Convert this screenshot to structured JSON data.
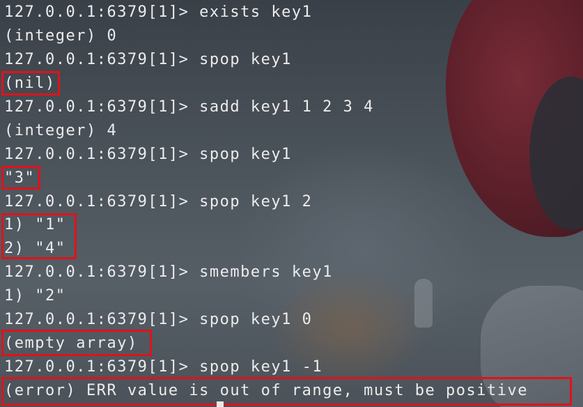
{
  "terminal": {
    "lines": [
      {
        "text": "127.0.0.1:6379[1]> exists key1",
        "kind": "prompt"
      },
      {
        "text": "(integer) 0",
        "kind": "output"
      },
      {
        "text": "127.0.0.1:6379[1]> spop key1",
        "kind": "prompt"
      },
      {
        "text": "(nil)",
        "kind": "output"
      },
      {
        "text": "127.0.0.1:6379[1]> sadd key1 1 2 3 4",
        "kind": "prompt"
      },
      {
        "text": "(integer) 4",
        "kind": "output"
      },
      {
        "text": "127.0.0.1:6379[1]> spop key1",
        "kind": "prompt"
      },
      {
        "text": "\"3\"",
        "kind": "output"
      },
      {
        "text": "127.0.0.1:6379[1]> spop key1 2",
        "kind": "prompt"
      },
      {
        "text": "1) \"1\"",
        "kind": "output"
      },
      {
        "text": "2) \"4\"",
        "kind": "output"
      },
      {
        "text": "127.0.0.1:6379[1]> smembers key1",
        "kind": "prompt"
      },
      {
        "text": "1) \"2\"",
        "kind": "output"
      },
      {
        "text": "127.0.0.1:6379[1]> spop key1 0",
        "kind": "prompt"
      },
      {
        "text": "(empty array)",
        "kind": "output"
      },
      {
        "text": "127.0.0.1:6379[1]> spop key1 -1",
        "kind": "prompt"
      },
      {
        "text": "(error) ERR value is out of range, must be positive",
        "kind": "error"
      }
    ]
  },
  "colors": {
    "text": "#ececec",
    "highlight_border": "#e0121a"
  }
}
